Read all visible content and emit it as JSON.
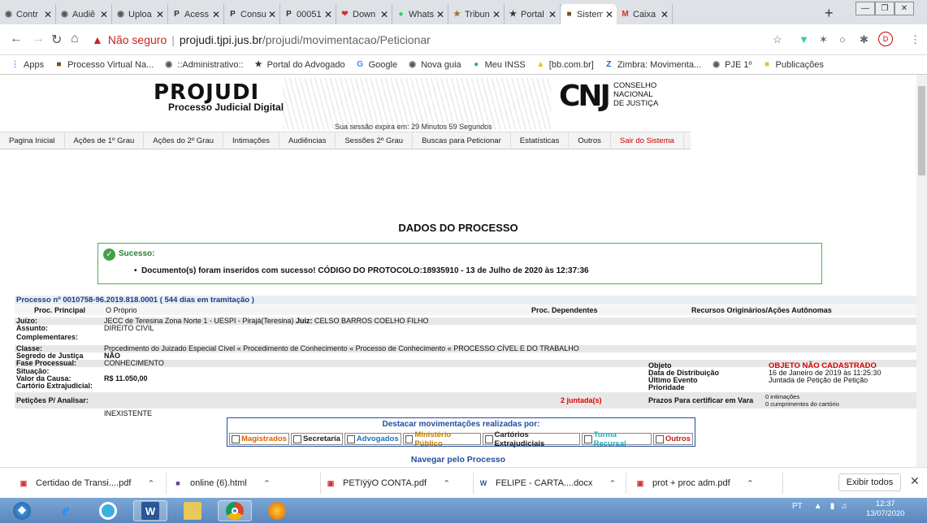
{
  "browser": {
    "tabs": [
      {
        "label": "Contr",
        "icon": "globe-icon",
        "active": false
      },
      {
        "label": "Audiê",
        "icon": "globe-icon",
        "active": false
      },
      {
        "label": "Uploa",
        "icon": "globe-icon",
        "active": false
      },
      {
        "label": "Acess",
        "icon": "pje-icon",
        "active": false
      },
      {
        "label": "Consu",
        "icon": "pje-icon",
        "active": false
      },
      {
        "label": "00051",
        "icon": "pje-icon",
        "active": false
      },
      {
        "label": "Down",
        "icon": "heart-icon",
        "active": false
      },
      {
        "label": "Whats",
        "icon": "whatsapp-icon",
        "active": false
      },
      {
        "label": "Tribun",
        "icon": "tribunal-icon",
        "active": false
      },
      {
        "label": "Portal",
        "icon": "portal-icon",
        "active": false
      },
      {
        "label": "Sistem",
        "icon": "projudi-icon",
        "active": true
      },
      {
        "label": "Caixa",
        "icon": "gmail-icon",
        "active": false
      }
    ],
    "new_tab": "+",
    "address": {
      "not_secure": "Não seguro",
      "separator": "|",
      "host": "projudi.tjpi.jus.br",
      "path": "/projudi/movimentacao/Peticionar"
    },
    "bookmarks": [
      {
        "label": "Apps",
        "icon": "apps-grid-icon"
      },
      {
        "label": "Processo Virtual Na...",
        "icon": "projudi-icon"
      },
      {
        "label": "::Administrativo::",
        "icon": "globe-icon"
      },
      {
        "label": "Portal do Advogado",
        "icon": "portal-icon"
      },
      {
        "label": "Google",
        "icon": "google-icon"
      },
      {
        "label": "Nova guia",
        "icon": "globe-icon"
      },
      {
        "label": "Meu INSS",
        "icon": "inss-icon"
      },
      {
        "label": "[bb.com.br]",
        "icon": "bb-icon"
      },
      {
        "label": "Zimbra: Movimenta...",
        "icon": "zimbra-icon"
      },
      {
        "label": "PJE 1º",
        "icon": "globe-icon"
      },
      {
        "label": "Publicações",
        "icon": "folder-icon"
      }
    ]
  },
  "header": {
    "logo_title": "PROJUDI",
    "logo_subtitle": "Processo Judicial Digital",
    "session": "Sua sessão expira em: 29 Minutos 59 Segundos",
    "cnj_mark": "CNJ",
    "cnj_line1": "CONSELHO",
    "cnj_line2": "NACIONAL",
    "cnj_line3": "DE JUSTIÇA"
  },
  "menu": [
    {
      "label": "Pagina Inicial",
      "danger": false
    },
    {
      "label": "Ações de 1º Grau",
      "danger": false
    },
    {
      "label": "Ações do 2º Grau",
      "danger": false
    },
    {
      "label": "Intimações",
      "danger": false
    },
    {
      "label": "Audiências",
      "danger": false
    },
    {
      "label": "Sessões 2º Grau",
      "danger": false
    },
    {
      "label": "Buscas para Peticionar",
      "danger": false
    },
    {
      "label": "Estatísticas",
      "danger": false
    },
    {
      "label": "Outros",
      "danger": false
    },
    {
      "label": "Sair do Sistema",
      "danger": true
    }
  ],
  "page": {
    "title": "DADOS DO PROCESSO",
    "success_title": "Sucesso:",
    "success_message": "Documento(s) foram inseridos com sucesso! CÓDIGO DO PROTOCOLO:18935910 - 13 de Julho de 2020 às 12:37:36",
    "process_header": "Processo nº 0010758-96.2019.818.0001 ( 544 dias em tramitação )",
    "proc_principal_label": "Proc. Principal",
    "proc_principal_value": "O Próprio",
    "proc_dependentes_label": "Proc. Dependentes",
    "recursos_label": "Recursos Originários/Ações Autônomas",
    "juizo_label": "Juízo:",
    "juizo_value": "JECC de Teresina Zona Norte 1 - UESPI - Pirajá(Teresina)",
    "juiz_label": "Juiz:",
    "juiz_value": "CELSO BARROS COELHO FILHO",
    "assunto_label": "Assunto:",
    "assunto_value": "DIREITO CIVIL",
    "complementares_label": "Complementares:",
    "classe_label": "Classe:",
    "classe_value": "Procedimento do Juizado Especial Cível « Procedimento de Conhecimento « Processo de Conhecimento « PROCESSO CÍVEL E DO TRABALHO",
    "segredo_label": "Segredo de Justiça",
    "segredo_value": "NÃO",
    "fase_label": "Fase Processual:",
    "fase_value": "CONHECIMENTO",
    "situacao_label": "Situação:",
    "valor_label": "Valor da Causa:",
    "valor_value": "R$ 11.050,00",
    "cartorio_label": "Cartório Extrajudicial:",
    "objeto_label": "Objeto",
    "objeto_value": "OBJETO NÃO CADASTRADO",
    "distrib_label": "Data de Distribuição",
    "distrib_value": "16 de Janeiro de 2019 às 11:25:30",
    "ultimo_label": "Último Evento",
    "ultimo_value": "Juntada de Petição de Petição",
    "prioridade_label": "Prioridade",
    "peticoes_label": "Petições P/ Analisar:",
    "peticoes_value": "INEXISTENTE",
    "juntadas_value": "2 juntada(s)",
    "prazos_label": "Prazos Para certificar em Vara",
    "intimacoes_value": "0 intimações",
    "cumprimentos_value": "0 cumprimentos do cartório",
    "destaque_title": "Destacar movimentações realizadas por:",
    "destaque_options": [
      {
        "label": "Magistrados",
        "color": "#e06000"
      },
      {
        "label": "Secretaria",
        "color": "#222222"
      },
      {
        "label": "Advogados",
        "color": "#1f6fc0"
      },
      {
        "label": "Ministério Público",
        "color": "#c08000"
      },
      {
        "label": "Cartórios Extrajudiciais",
        "color": "#222222"
      },
      {
        "label": "Turma Recursal",
        "color": "#20b0c0"
      },
      {
        "label": "Outros",
        "color": "#c02020"
      }
    ],
    "nav_title": "Navegar pelo Processo"
  },
  "downloads": {
    "items": [
      {
        "label": "Certidao de Transi....pdf",
        "icon": "pdf-icon"
      },
      {
        "label": "online (6).html",
        "icon": "html-file-icon"
      },
      {
        "label": "PETIÿÿO CONTA.pdf",
        "icon": "pdf-icon"
      },
      {
        "label": "FELIPE - CARTA....docx",
        "icon": "word-file-icon"
      },
      {
        "label": "prot + proc adm.pdf",
        "icon": "pdf-icon"
      }
    ],
    "show_all": "Exibir todos"
  },
  "taskbar": {
    "lang": "PT",
    "time": "12:37",
    "date": "13/07/2020"
  }
}
